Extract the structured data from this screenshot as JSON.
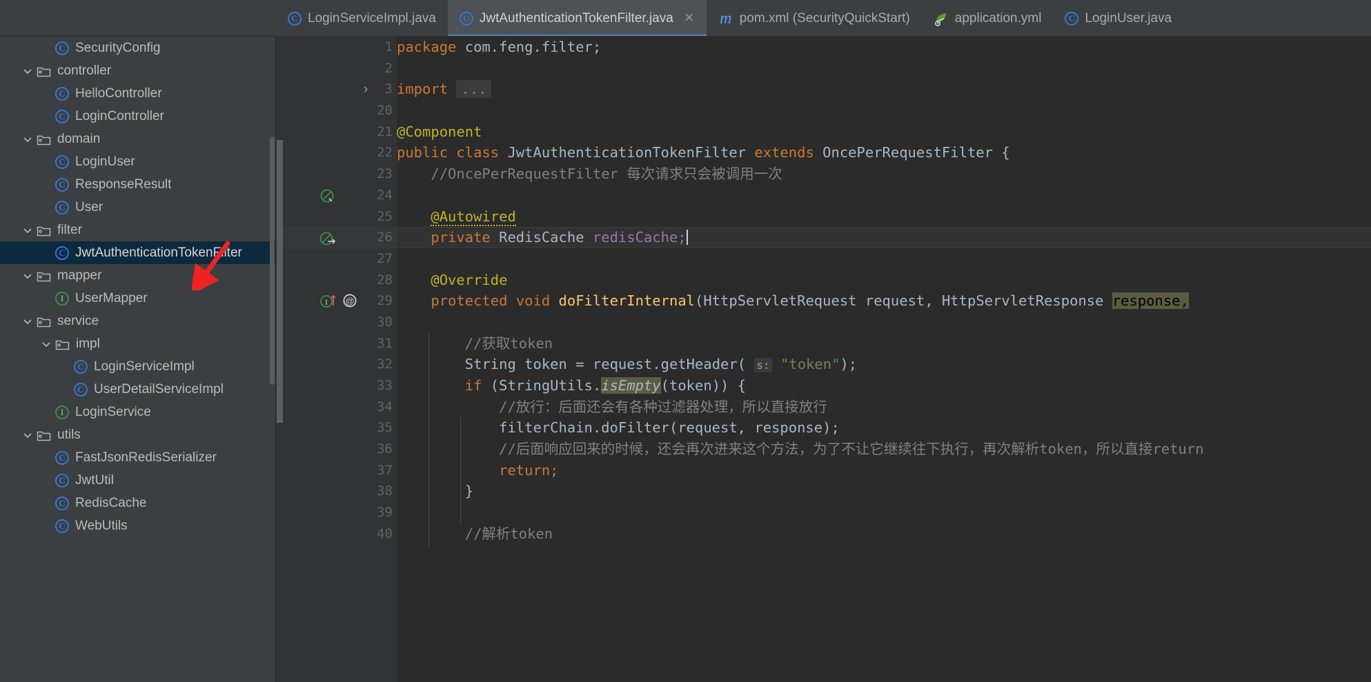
{
  "window": {
    "background": "#3c3f41",
    "editor_background": "#2b2b2b",
    "accent": "#4a88c7",
    "selection_background": "#0d293e"
  },
  "tabs": [
    {
      "label": "LoginServiceImpl.java",
      "icon": "java-class-icon",
      "active": false,
      "closable": false
    },
    {
      "label": "JwtAuthenticationTokenFilter.java",
      "icon": "java-class-icon",
      "active": true,
      "closable": true,
      "close_label": "✕"
    },
    {
      "label": "pom.xml (SecurityQuickStart)",
      "icon": "maven-icon",
      "active": false,
      "closable": false
    },
    {
      "label": "application.yml",
      "icon": "spring-leaf-icon",
      "active": false,
      "closable": false
    },
    {
      "label": "LoginUser.java",
      "icon": "java-class-icon",
      "active": false,
      "closable": false
    }
  ],
  "project_tree": {
    "items": [
      {
        "label": "SecurityConfig",
        "icon": "java-class-icon",
        "indent": 3,
        "chevron": "",
        "selected": false
      },
      {
        "label": "controller",
        "icon": "package-folder-icon",
        "indent": 2,
        "chevron": "⌄",
        "selected": false
      },
      {
        "label": "HelloController",
        "icon": "java-class-icon",
        "indent": 3,
        "chevron": "",
        "selected": false
      },
      {
        "label": "LoginController",
        "icon": "java-class-icon",
        "indent": 3,
        "chevron": "",
        "selected": false
      },
      {
        "label": "domain",
        "icon": "package-folder-icon",
        "indent": 2,
        "chevron": "⌄",
        "selected": false
      },
      {
        "label": "LoginUser",
        "icon": "java-class-icon",
        "indent": 3,
        "chevron": "",
        "selected": false
      },
      {
        "label": "ResponseResult",
        "icon": "java-class-icon",
        "indent": 3,
        "chevron": "",
        "selected": false
      },
      {
        "label": "User",
        "icon": "java-class-icon",
        "indent": 3,
        "chevron": "",
        "selected": false
      },
      {
        "label": "filter",
        "icon": "package-folder-icon",
        "indent": 2,
        "chevron": "⌄",
        "selected": false
      },
      {
        "label": "JwtAuthenticationTokenFilter",
        "icon": "java-class-icon",
        "indent": 3,
        "chevron": "",
        "selected": true
      },
      {
        "label": "mapper",
        "icon": "package-folder-icon",
        "indent": 2,
        "chevron": "⌄",
        "selected": false
      },
      {
        "label": "UserMapper",
        "icon": "java-interface-icon",
        "indent": 3,
        "chevron": "",
        "selected": false
      },
      {
        "label": "service",
        "icon": "package-folder-icon",
        "indent": 2,
        "chevron": "⌄",
        "selected": false
      },
      {
        "label": "impl",
        "icon": "package-folder-icon",
        "indent": 3,
        "chevron": "⌄",
        "selected": false
      },
      {
        "label": "LoginServiceImpl",
        "icon": "java-class-icon",
        "indent": 4,
        "chevron": "",
        "selected": false
      },
      {
        "label": "UserDetailServiceImpl",
        "icon": "java-class-icon",
        "indent": 4,
        "chevron": "",
        "selected": false
      },
      {
        "label": "LoginService",
        "icon": "java-interface-icon",
        "indent": 3,
        "chevron": "",
        "selected": false
      },
      {
        "label": "utils",
        "icon": "package-folder-icon",
        "indent": 2,
        "chevron": "⌄",
        "selected": false
      },
      {
        "label": "FastJsonRedisSerializer",
        "icon": "java-class-icon",
        "indent": 3,
        "chevron": "",
        "selected": false
      },
      {
        "label": "JwtUtil",
        "icon": "java-class-icon",
        "indent": 3,
        "chevron": "",
        "selected": false
      },
      {
        "label": "RedisCache",
        "icon": "java-class-icon",
        "indent": 3,
        "chevron": "",
        "selected": false
      },
      {
        "label": "WebUtils",
        "icon": "java-class-icon",
        "indent": 3,
        "chevron": "",
        "selected": false
      }
    ],
    "annotation_arrow_color": "#ee2222"
  },
  "editor": {
    "file": "JwtAuthenticationTokenFilter.java",
    "caret_line": 26,
    "line_numbers": [
      "1",
      "2",
      "3",
      "20",
      "21",
      "22",
      "23",
      "24",
      "25",
      "26",
      "27",
      "28",
      "29",
      "30",
      "31",
      "32",
      "33",
      "34",
      "35",
      "36",
      "37",
      "38",
      "39",
      "40"
    ],
    "gutter_icons": {
      "line_3": "fold-expand-chevron-icon",
      "line_22": "bean-class-gutter-icon",
      "line_26": "autowired-dependency-gutter-icon",
      "line_29": "implementing-method-gutter-icon",
      "line_29b": "annotation-gutter-icon"
    },
    "code_lines": [
      {
        "n": "1",
        "text": "package com.feng.filter;"
      },
      {
        "n": "2",
        "text": ""
      },
      {
        "n": "3",
        "text": "import ..."
      },
      {
        "n": "20",
        "text": ""
      },
      {
        "n": "21",
        "text": "@Component"
      },
      {
        "n": "22",
        "text": "public class JwtAuthenticationTokenFilter extends OncePerRequestFilter {"
      },
      {
        "n": "23",
        "text": "    //OncePerRequestFilter 每次请求只会被调用一次"
      },
      {
        "n": "24",
        "text": ""
      },
      {
        "n": "25",
        "text": "    @Autowired"
      },
      {
        "n": "26",
        "text": "    private RedisCache redisCache;"
      },
      {
        "n": "27",
        "text": ""
      },
      {
        "n": "28",
        "text": "    @Override"
      },
      {
        "n": "29",
        "text": "    protected void doFilterInternal(HttpServletRequest request, HttpServletResponse response,"
      },
      {
        "n": "30",
        "text": ""
      },
      {
        "n": "31",
        "text": "        //获取token"
      },
      {
        "n": "32",
        "text": "        String token = request.getHeader( s: \"token\");"
      },
      {
        "n": "33",
        "text": "        if (StringUtils.isEmpty(token)) {"
      },
      {
        "n": "34",
        "text": "            //放行：后面还会有各种过滤器处理，所以直接放行"
      },
      {
        "n": "35",
        "text": "            filterChain.doFilter(request, response);"
      },
      {
        "n": "36",
        "text": "            //后面响应回来的时候，还会再次进来这个方法，为了不让它继续往下执行，再次解析token，所以直接return"
      },
      {
        "n": "37",
        "text": "            return;"
      },
      {
        "n": "38",
        "text": "        }"
      },
      {
        "n": "39",
        "text": ""
      },
      {
        "n": "40",
        "text": "        //解析token"
      }
    ],
    "tokens": {
      "kw_package": "package",
      "pkg_name": "com.feng.filter;",
      "kw_import": "import",
      "import_fold": "...",
      "ann_component": "@Component",
      "kw_public": "public",
      "kw_class": "class",
      "class_name": "JwtAuthenticationTokenFilter",
      "kw_extends": "extends",
      "super_name": "OncePerRequestFilter",
      "brace_open": "{",
      "comment_23": "//OncePerRequestFilter 每次请求只会被调用一次",
      "ann_autowired": "@Autowired",
      "kw_private": "private",
      "type_rediscache": "RedisCache",
      "field_rediscache": "redisCache;",
      "ann_override": "@Override",
      "kw_protected": "protected",
      "kw_void": "void",
      "method_name": "doFilterInternal",
      "paren_open": "(",
      "type_request": "HttpServletRequest",
      "param_request": "request,",
      "type_response": "HttpServletResponse",
      "param_response": "response,",
      "comment_31": "//获取token",
      "type_string": "String",
      "var_token": "token",
      "eq": "=",
      "call_getheader": "request.getHeader(",
      "hint_s": "s:",
      "str_token": "\"token\"",
      "close_semi": ");",
      "kw_if": "if",
      "stringutils": "(StringUtils.",
      "isempty": "isEmpty",
      "isempty_args": "(token)) {",
      "comment_34": "//放行：后面还会有各种过滤器处理，所以直接放行",
      "filterchain": "filterChain.doFilter(request, response);",
      "comment_36": "//后面响应回来的时候，还会再次进来这个方法，为了不让它继续往下执行，再次解析token，所以直接return",
      "kw_return": "return;",
      "brace_close": "}",
      "comment_40": "//解析token",
      "fold_chevron": "›"
    }
  }
}
